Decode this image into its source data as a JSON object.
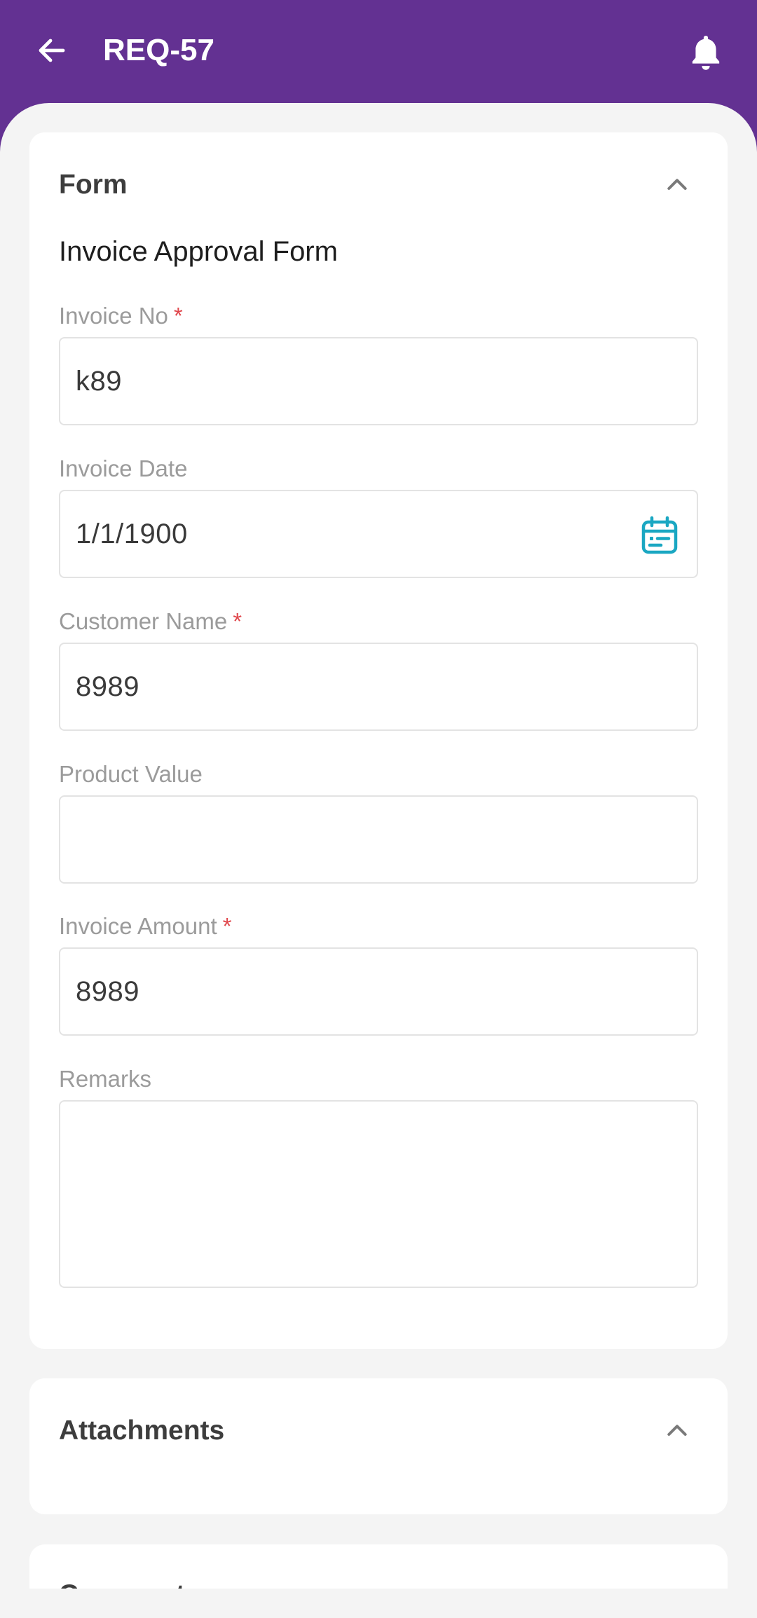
{
  "header": {
    "title": "REQ-57",
    "back_icon": "arrow-left-icon",
    "notification_icon": "bell-icon",
    "color": "#633192"
  },
  "form_section": {
    "title": "Form",
    "form_name": "Invoice Approval Form",
    "required_marker": "*",
    "fields": {
      "invoice_no": {
        "label": "Invoice No",
        "value": "k89",
        "required": true
      },
      "invoice_date": {
        "label": "Invoice Date",
        "value": "1/1/1900",
        "icon": "calendar-icon"
      },
      "customer_name": {
        "label": "Customer Name",
        "value": "8989",
        "required": true
      },
      "product_value": {
        "label": "Product Value",
        "value": ""
      },
      "invoice_amount": {
        "label": "Invoice Amount",
        "value": "8989",
        "required": true
      },
      "remarks": {
        "label": "Remarks",
        "value": ""
      }
    }
  },
  "attachments_section": {
    "title": "Attachments"
  },
  "comments_section": {
    "title": "Comments"
  },
  "colors": {
    "accent_icon": "#1aa7c2",
    "required": "#e0474c"
  }
}
